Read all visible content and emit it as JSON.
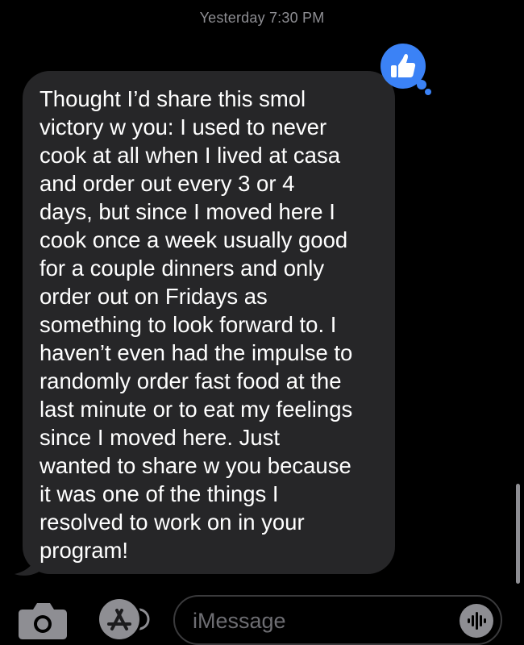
{
  "conversation": {
    "timestamp": "Yesterday 7:30 PM",
    "message": {
      "text": "Thought I’d share this smol\nvictory w you: I used to never\ncook at all when I lived at casa\nand order out every 3 or 4\ndays, but since I moved here I\ncook once a week usually good\nfor a couple dinners and only\norder out on Fridays as\nsomething to look forward to. I\nhaven’t even had the impulse to\nrandomly order fast food at the\nlast minute or to eat my feelings\nsince I moved here. Just\nwanted to share w you because\nit was one of the things I\nresolved to work on  in your\nprogram!",
      "reaction": "thumbs-up-icon"
    }
  },
  "composer": {
    "placeholder": "iMessage",
    "icons": [
      "camera-icon",
      "app-store-icon",
      "voice-waveform-icon"
    ]
  },
  "colors": {
    "background": "#000000",
    "bubble": "#262628",
    "accent": "#3b82f6",
    "text": "#ffffff",
    "secondary_text": "#8e8e93"
  }
}
